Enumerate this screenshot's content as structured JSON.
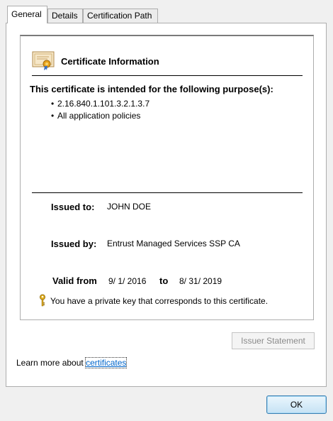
{
  "tabs": [
    "General",
    "Details",
    "Certification Path"
  ],
  "info": {
    "title": "Certificate Information",
    "purpose_heading": "This certificate is intended for the following purpose(s):",
    "purposes": [
      "2.16.840.1.101.3.2.1.3.7",
      "All application policies"
    ]
  },
  "issued_to": {
    "label": "Issued to:",
    "value": "JOHN DOE"
  },
  "issued_by": {
    "label": "Issued by:",
    "value": "Entrust Managed Services SSP CA"
  },
  "valid": {
    "label": "Valid from",
    "from": "9/ 1/ 2016",
    "to_label": "to",
    "to": "8/ 31/ 2019"
  },
  "private_key_message": "You have a private key that corresponds to this certificate.",
  "issuer_statement_label": "Issuer Statement",
  "learn_more": {
    "prefix": "Learn more about ",
    "link": "certificates"
  },
  "ok_label": "OK",
  "icons": {
    "certificate": "certificate-icon",
    "key": "key-icon"
  }
}
